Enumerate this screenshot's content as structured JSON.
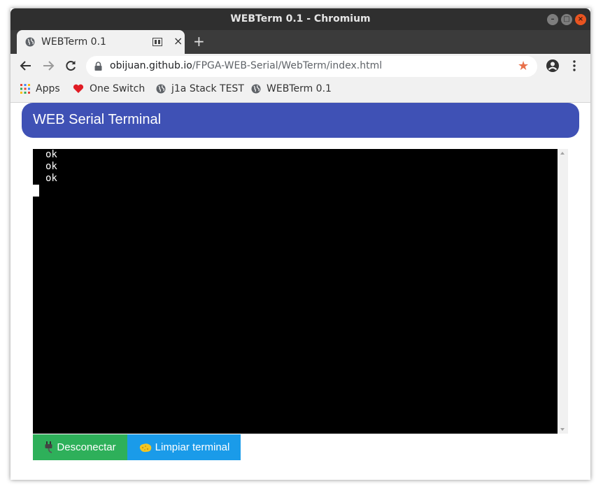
{
  "window": {
    "title": "WEBTerm 0.1 - Chromium"
  },
  "tab": {
    "title": "WEBTerm 0.1",
    "close_glyph": "×",
    "newtab_glyph": "+"
  },
  "address": {
    "host": "obijuan.github.io",
    "path": "/FPGA-WEB-Serial/WebTerm/index.html"
  },
  "bookmarks": [
    {
      "label": "Apps",
      "icon": "apps-grid-icon"
    },
    {
      "label": "One Switch",
      "icon": "heart-icon"
    },
    {
      "label": "j1a Stack TEST",
      "icon": "globe-icon"
    },
    {
      "label": "WEBTerm 0.1",
      "icon": "globe-icon"
    }
  ],
  "app": {
    "title": "WEB Serial Terminal"
  },
  "terminal": {
    "lines": [
      "ok",
      "ok",
      "ok"
    ]
  },
  "buttons": {
    "disconnect": {
      "label": "Desconectar",
      "icon": "plug-icon"
    },
    "clear": {
      "label": "Limpiar terminal",
      "icon": "sponge-icon"
    }
  },
  "colors": {
    "header": "#3f51b5",
    "disconnect": "#2eb05a",
    "clear": "#1a9be9",
    "terminal_bg": "#000000"
  }
}
